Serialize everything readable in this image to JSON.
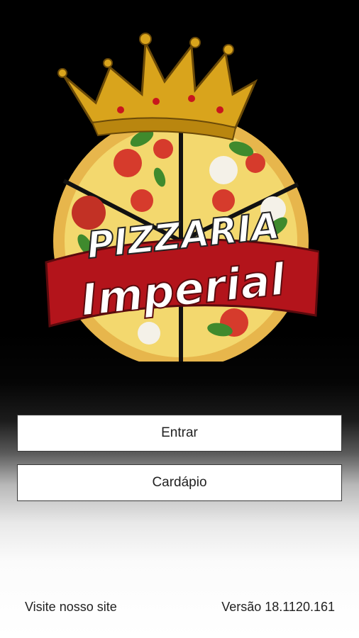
{
  "logo": {
    "line1": "PIZZARIA",
    "line2": "Imperial",
    "icons": [
      "crown-icon",
      "pizza-icon"
    ],
    "colors": {
      "crown_gold": "#d9a41c",
      "ribbon_red": "#b3141b",
      "crust": "#e7b64c",
      "cheese": "#f3d86e",
      "tomato": "#d63b2c",
      "basil": "#3f8a2d"
    }
  },
  "buttons": {
    "entrar": "Entrar",
    "cardapio": "Cardápio"
  },
  "footer": {
    "site_link": "Visite nosso site",
    "version": "Versão 18.1120.161"
  }
}
